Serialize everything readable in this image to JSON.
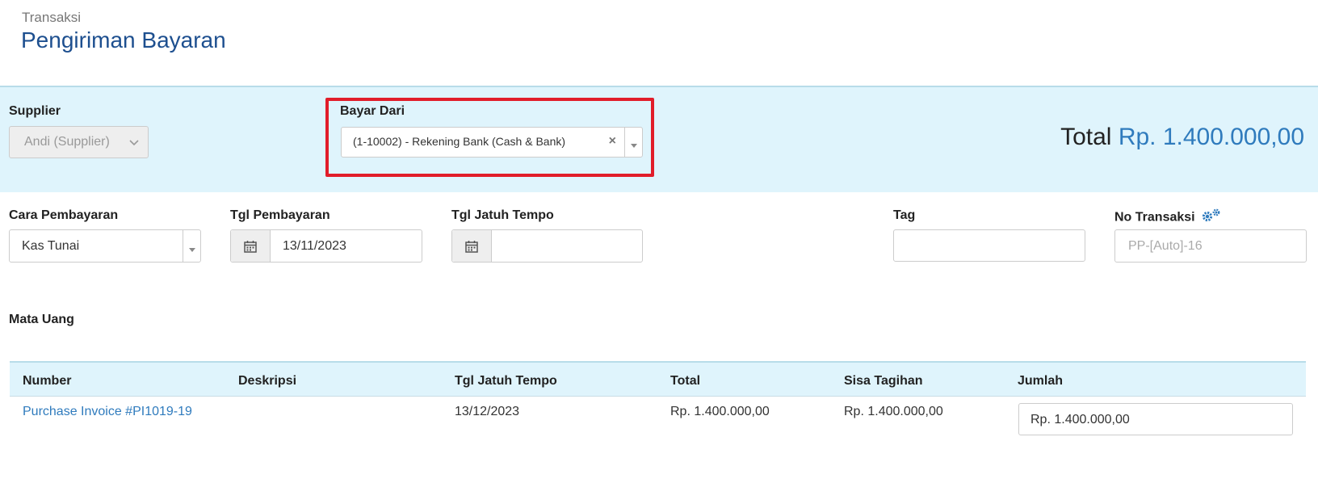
{
  "page": {
    "breadcrumb": "Transaksi",
    "title": "Pengiriman Bayaran"
  },
  "header": {
    "supplier_label": "Supplier",
    "supplier_value": "Andi (Supplier)",
    "bayar_dari_label": "Bayar Dari",
    "bayar_dari_value": "(1-10002) - Rekening Bank (Cash & Bank)",
    "total_label": "Total",
    "total_amount": "Rp. 1.400.000,00"
  },
  "form": {
    "cara_label": "Cara Pembayaran",
    "cara_value": "Kas Tunai",
    "tgl_pembayaran_label": "Tgl Pembayaran",
    "tgl_pembayaran_value": "13/11/2023",
    "tgl_jatuh_tempo_label": "Tgl Jatuh Tempo",
    "tgl_jatuh_tempo_value": "",
    "tag_label": "Tag",
    "tag_value": "",
    "no_transaksi_label": "No Transaksi",
    "no_transaksi_placeholder": "PP-[Auto]-16",
    "mata_uang_label": "Mata Uang"
  },
  "table": {
    "headers": [
      "Number",
      "Deskripsi",
      "Tgl Jatuh Tempo",
      "Total",
      "Sisa Tagihan",
      "Jumlah"
    ],
    "rows": [
      {
        "number": "Purchase Invoice #PI1019-19",
        "deskripsi": "",
        "tgl_jatuh_tempo": "13/12/2023",
        "total": "Rp. 1.400.000,00",
        "sisa_tagihan": "Rp. 1.400.000,00",
        "jumlah": "Rp. 1.400.000,00"
      }
    ]
  },
  "icons": {
    "calendar": "calendar-icon",
    "gear": "gear-icon",
    "clear": "clear-icon",
    "chevron": "chevron-down-icon"
  },
  "colors": {
    "title": "#1d4f8f",
    "accent": "#2f7bbd",
    "band": "#dff4fc",
    "highlight": "#e11d2a"
  }
}
